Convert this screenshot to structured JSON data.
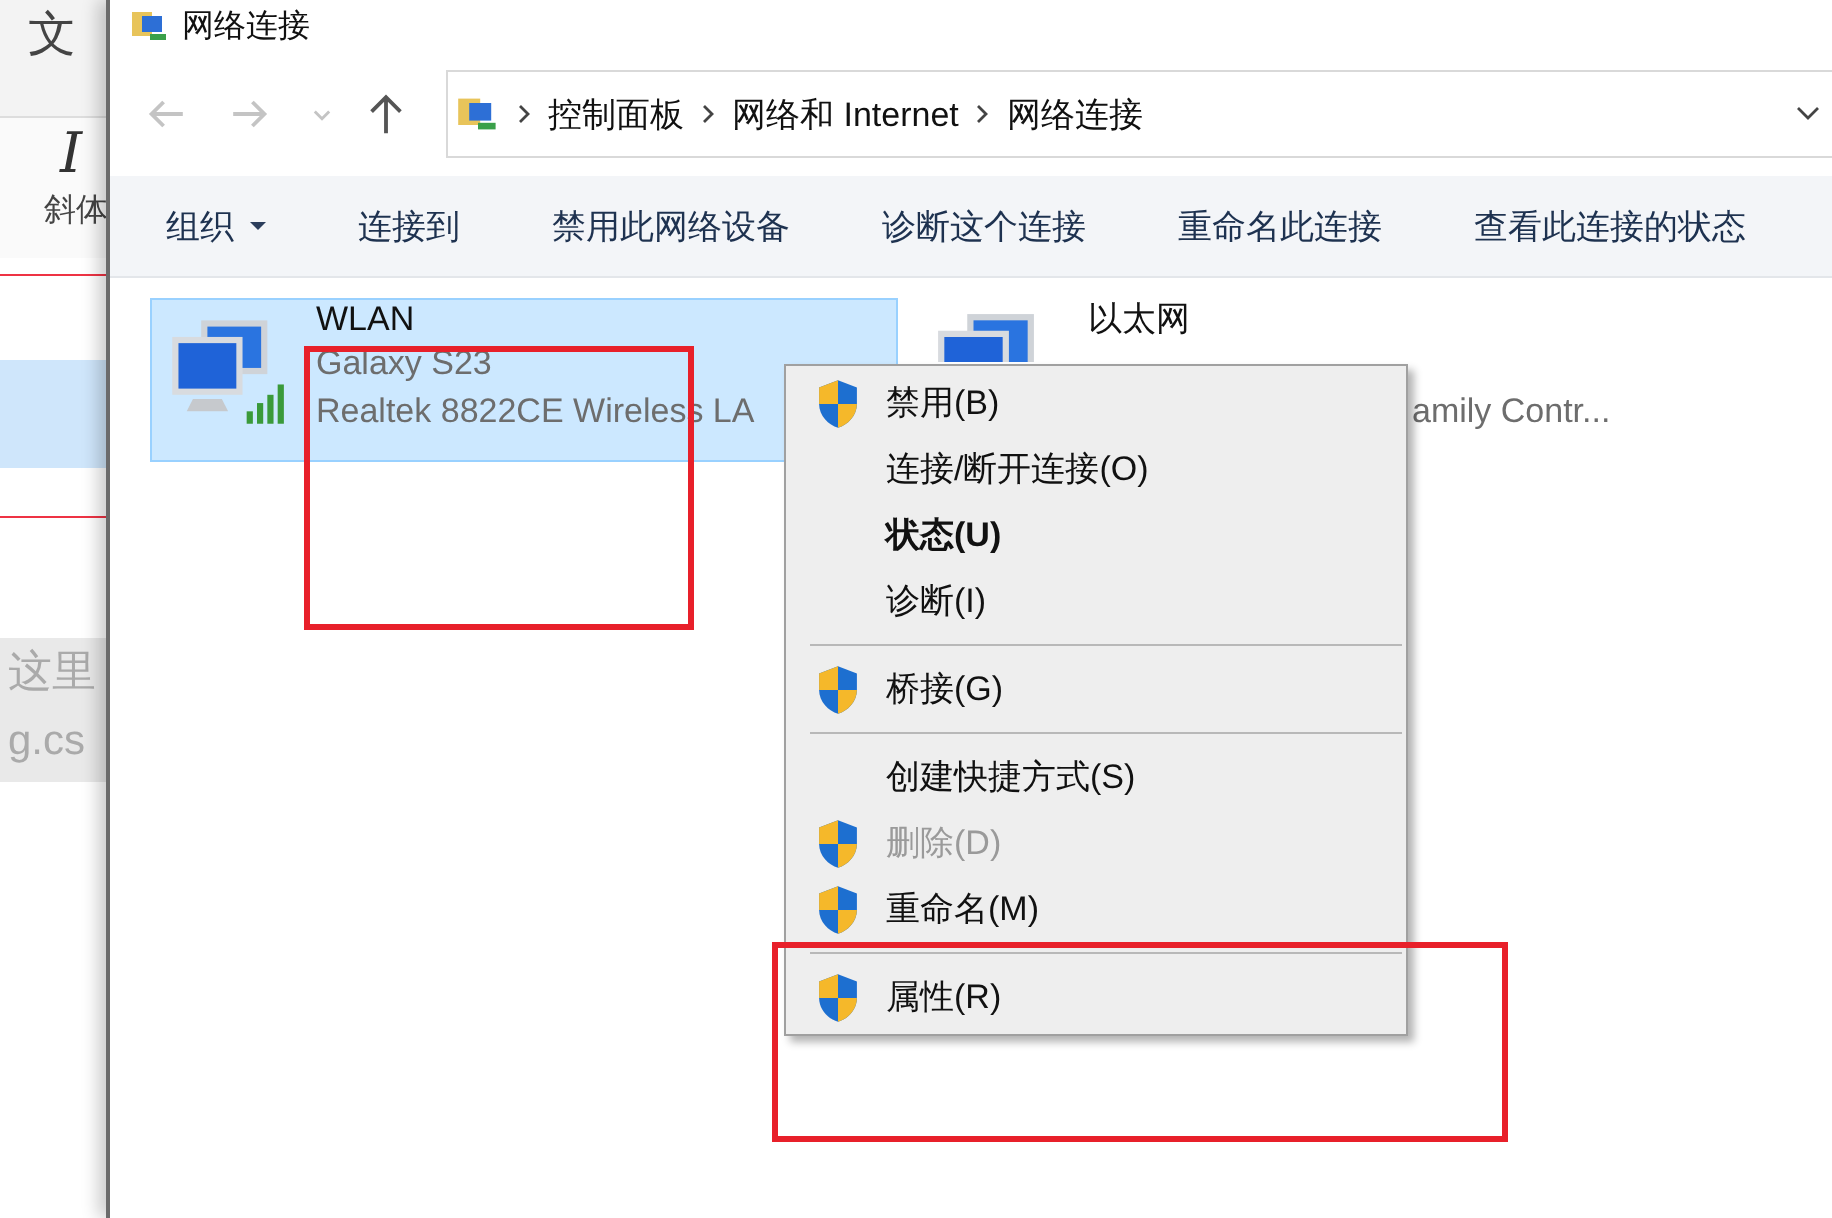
{
  "background_window": {
    "title": "文",
    "italic_button": {
      "glyph": "I",
      "label": "斜体"
    },
    "placeholder_text": "这里",
    "url_text": "g.cs"
  },
  "window": {
    "title": "网络连接"
  },
  "address_bar": {
    "breadcrumbs": [
      "控制面板",
      "网络和 Internet",
      "网络连接"
    ]
  },
  "toolbar": {
    "items": [
      {
        "label": "组织",
        "dropdown": true
      },
      {
        "label": "连接到",
        "dropdown": false
      },
      {
        "label": "禁用此网络设备",
        "dropdown": false
      },
      {
        "label": "诊断这个连接",
        "dropdown": false
      },
      {
        "label": "重命名此连接",
        "dropdown": false
      },
      {
        "label": "查看此连接的状态",
        "dropdown": false
      }
    ]
  },
  "connections": [
    {
      "name": "WLAN",
      "kind": "wireless",
      "selected": true,
      "network": "Galaxy S23",
      "adapter": "Realtek 8822CE Wireless LA"
    },
    {
      "name": "以太网",
      "kind": "ethernet",
      "selected": false,
      "adapter": "amily Contr..."
    }
  ],
  "context_menu": {
    "items": [
      {
        "kind": "item",
        "label": "禁用(B)",
        "shield": true,
        "bold": false,
        "disabled": false
      },
      {
        "kind": "item",
        "label": "连接/断开连接(O)",
        "shield": false,
        "bold": false,
        "disabled": false
      },
      {
        "kind": "item",
        "label": "状态(U)",
        "shield": false,
        "bold": true,
        "disabled": false
      },
      {
        "kind": "item",
        "label": "诊断(I)",
        "shield": false,
        "bold": false,
        "disabled": false
      },
      {
        "kind": "separator"
      },
      {
        "kind": "item",
        "label": "桥接(G)",
        "shield": true,
        "bold": false,
        "disabled": false
      },
      {
        "kind": "separator"
      },
      {
        "kind": "item",
        "label": "创建快捷方式(S)",
        "shield": false,
        "bold": false,
        "disabled": false
      },
      {
        "kind": "item",
        "label": "删除(D)",
        "shield": true,
        "bold": false,
        "disabled": true
      },
      {
        "kind": "item",
        "label": "重命名(M)",
        "shield": true,
        "bold": false,
        "disabled": false
      },
      {
        "kind": "separator"
      },
      {
        "kind": "item",
        "label": "属性(R)",
        "shield": true,
        "bold": false,
        "disabled": false
      }
    ]
  },
  "annotations": [
    {
      "color": "#e8202a"
    },
    {
      "color": "#e8202a"
    }
  ]
}
